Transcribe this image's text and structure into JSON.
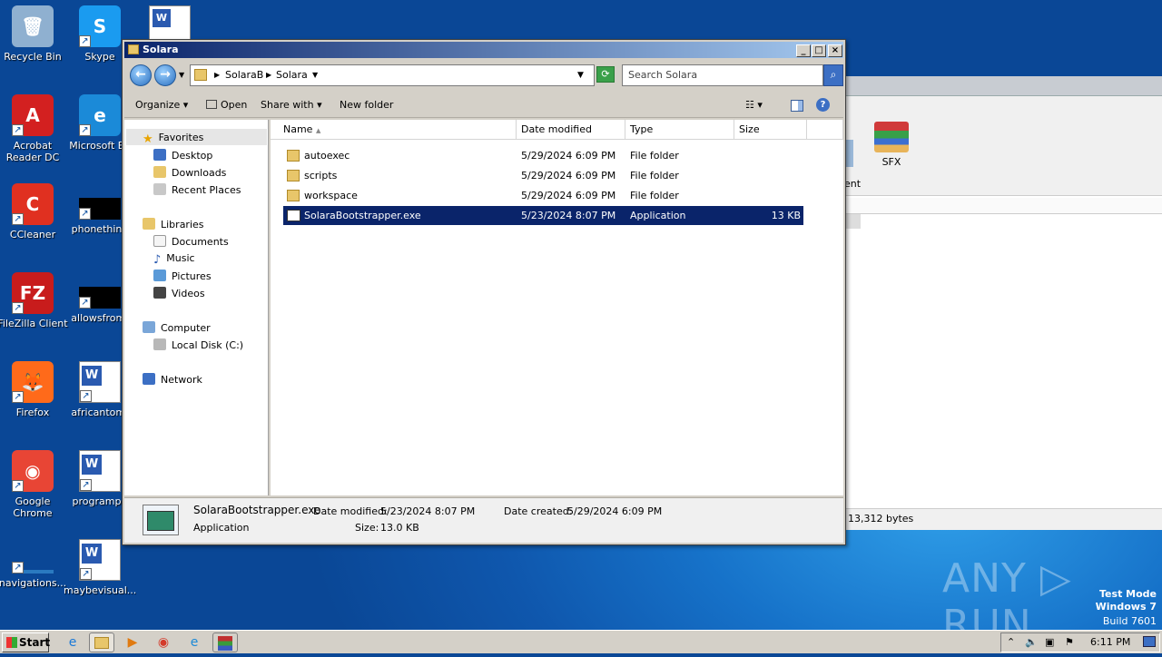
{
  "desktop": {
    "icons": [
      {
        "label": "Recycle Bin",
        "glyph": "🗑",
        "color": "#8fb0d0"
      },
      {
        "label": "Skype",
        "glyph": "S",
        "color": "#1a9bf0"
      },
      {
        "label": "Acrobat Reader DC",
        "glyph": "A",
        "color": "#d32020"
      },
      {
        "label": "Microsoft Ed",
        "glyph": "e",
        "color": "#1b8ad8"
      },
      {
        "label": "CCleaner",
        "glyph": "C",
        "color": "#e03020"
      },
      {
        "label": "phonething",
        "glyph": "",
        "color": "#000000"
      },
      {
        "label": "FileZilla Client",
        "glyph": "FZ",
        "color": "#c81c1c"
      },
      {
        "label": "allowsfrom.",
        "glyph": "",
        "color": "#000000"
      },
      {
        "label": "Firefox",
        "glyph": "🦊",
        "color": "#ff6a1a"
      },
      {
        "label": "africantom.",
        "glyph": "W",
        "color": "#2a5ab0"
      },
      {
        "label": "Google Chrome",
        "glyph": "◉",
        "color": "#e84535"
      },
      {
        "label": "programph",
        "glyph": "W",
        "color": "#2a5ab0"
      },
      {
        "label": "navigations...",
        "glyph": "",
        "color": "#2a7ac0"
      },
      {
        "label": "maybevisual...",
        "glyph": "W",
        "color": "#2a5ab0"
      }
    ],
    "top_word_icon": "W"
  },
  "background_app": {
    "items": [
      {
        "label": "ent"
      },
      {
        "label": "SFX"
      }
    ],
    "status": "13,312 bytes"
  },
  "explorer": {
    "title": "Solara",
    "breadcrumb": [
      "SolaraB",
      "Solara"
    ],
    "search_placeholder": "Search Solara",
    "commands": {
      "organize": "Organize",
      "open": "Open",
      "share": "Share with",
      "new_folder": "New folder"
    },
    "nav": {
      "favorites": "Favorites",
      "fav_items": [
        "Desktop",
        "Downloads",
        "Recent Places"
      ],
      "libraries": "Libraries",
      "lib_items": [
        "Documents",
        "Music",
        "Pictures",
        "Videos"
      ],
      "computer": "Computer",
      "comp_items": [
        "Local Disk (C:)"
      ],
      "network": "Network"
    },
    "columns": {
      "name": "Name",
      "date": "Date modified",
      "type": "Type",
      "size": "Size"
    },
    "files": [
      {
        "name": "autoexec",
        "date": "5/29/2024 6:09 PM",
        "type": "File folder",
        "size": ""
      },
      {
        "name": "scripts",
        "date": "5/29/2024 6:09 PM",
        "type": "File folder",
        "size": ""
      },
      {
        "name": "workspace",
        "date": "5/29/2024 6:09 PM",
        "type": "File folder",
        "size": ""
      },
      {
        "name": "SolaraBootstrapper.exe",
        "date": "5/23/2024 8:07 PM",
        "type": "Application",
        "size": "13 KB"
      }
    ],
    "details": {
      "name": "SolaraBootstrapper.exe",
      "kind": "Application",
      "modified_label": "Date modified:",
      "modified": "5/23/2024 8:07 PM",
      "size_label": "Size:",
      "size": "13.0 KB",
      "created_label": "Date created:",
      "created": "5/29/2024 6:09 PM"
    }
  },
  "taskbar": {
    "start": "Start",
    "clock": "6:11 PM"
  },
  "watermark": {
    "brand": "ANY ▷ RUN",
    "line1": "Test Mode",
    "line2": "Windows 7",
    "line3": "Build 7601"
  }
}
